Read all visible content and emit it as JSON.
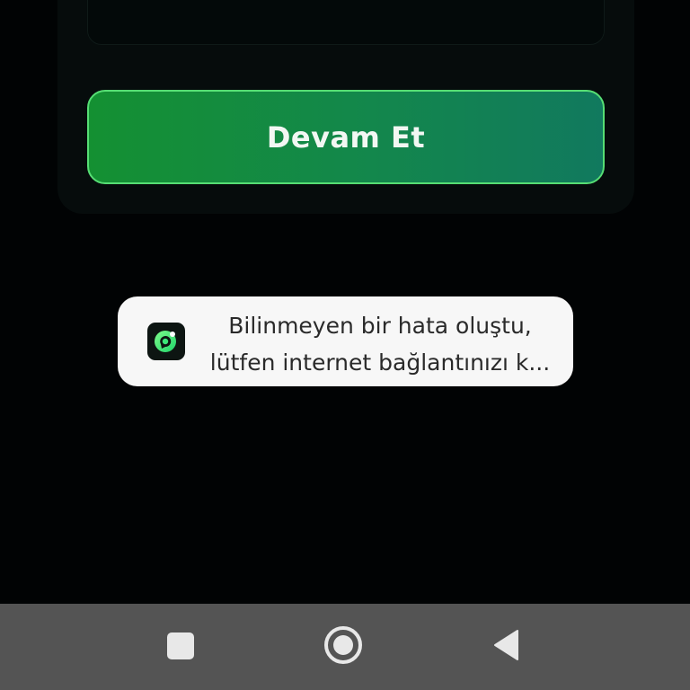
{
  "form": {
    "continue_label": "Devam Et"
  },
  "toast": {
    "line1": "Bilinmeyen bir hata oluştu,",
    "line2": "lütfen internet bağlantınızı k...",
    "icon": "app-logo-icon"
  },
  "navbar": {
    "recent_icon": "square-icon",
    "home_icon": "circle-icon",
    "back_icon": "triangle-back-icon"
  },
  "colors": {
    "background": "#010304",
    "button_start": "#149032",
    "button_end": "#11795e",
    "button_border": "#56de74",
    "toast_bg": "#f7f7f7",
    "navbar_bg": "#545454"
  }
}
